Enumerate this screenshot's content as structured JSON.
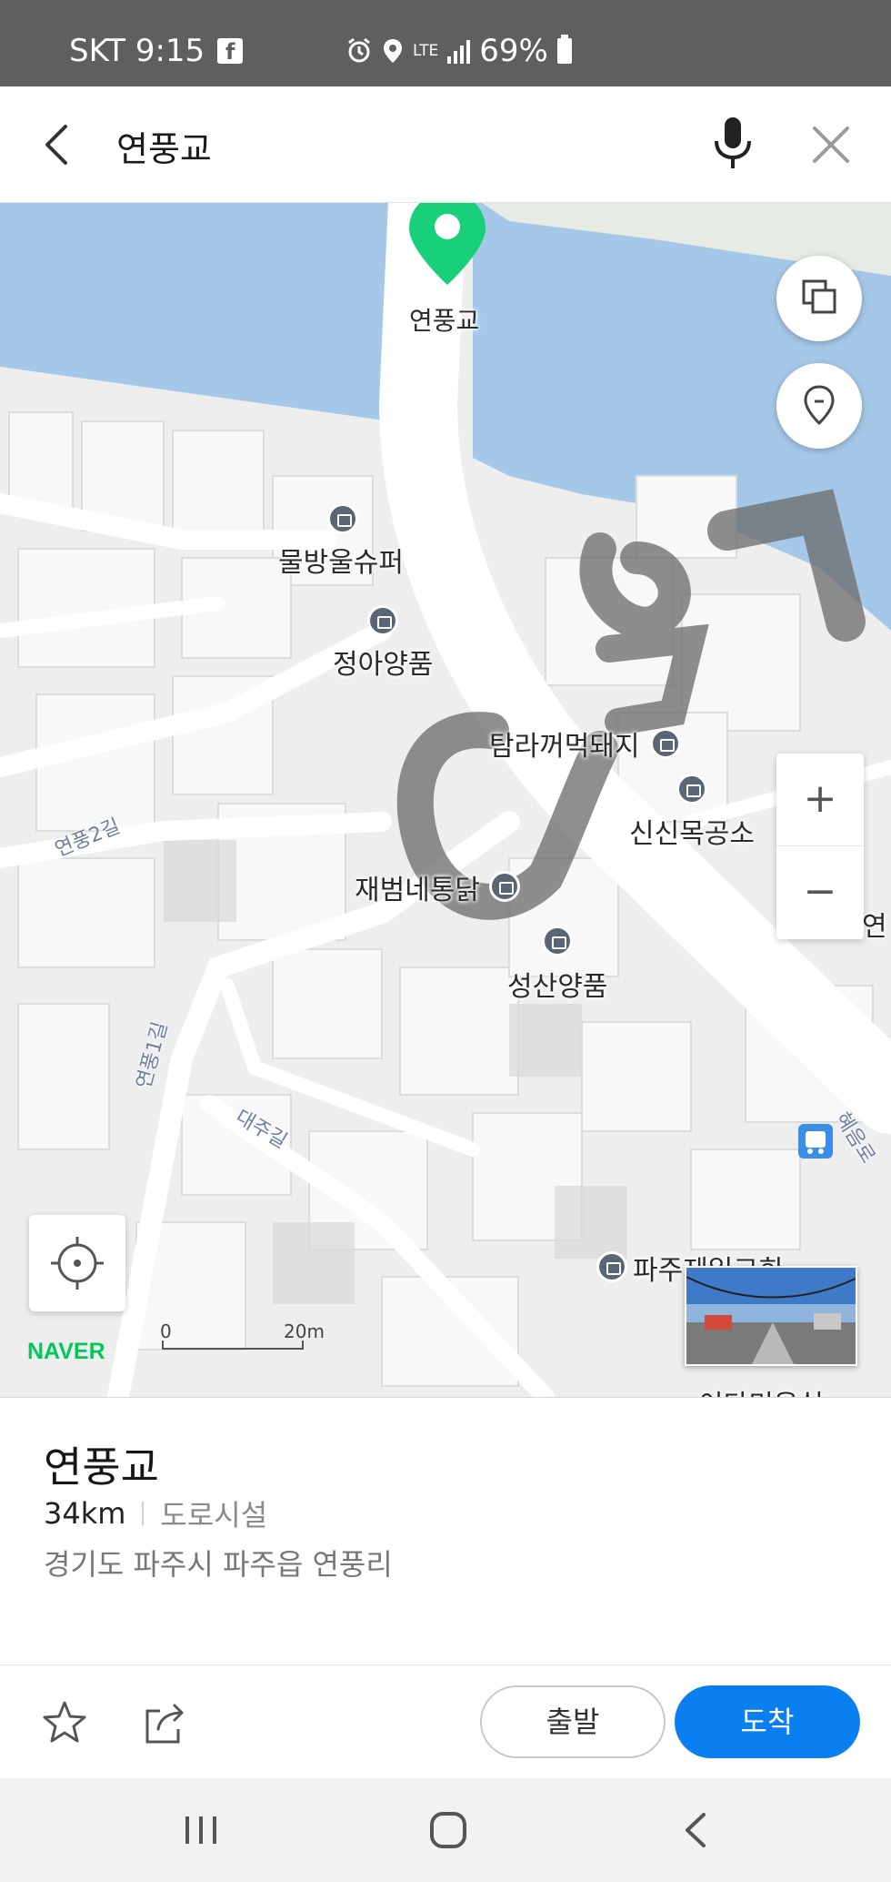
{
  "status_bar": {
    "carrier_time": "SKT 9:15",
    "fb_glyph": "f",
    "lte": "LTE",
    "battery": "69%"
  },
  "search": {
    "query": "연풍교"
  },
  "map": {
    "pin_label": "연풍교",
    "pois": {
      "supermarket": "물방울슈퍼",
      "jeonga": "정아양품",
      "tamra": "탐라꺼먹돼지",
      "sinsin": "신신목공소",
      "jaebeom": "재범네통닭",
      "seongsan": "성산양품",
      "church": "파주제일교회",
      "bottom_poi": "이다미용실",
      "edge_label": "연"
    },
    "roads": {
      "yeonpung2": "연풍2길",
      "yeonpung1": "연풍1길",
      "daeju": "대주길",
      "hyeeum": "혜음로"
    },
    "zoom": {
      "plus": "+",
      "minus": "−"
    },
    "logo": "NAVER",
    "scale": {
      "start": "0",
      "end": "20m"
    },
    "colors": {
      "water": "#a6c8e8",
      "road": "#ffffff",
      "building": "#f6f6f6",
      "pin": "#19d07a"
    }
  },
  "place": {
    "name": "연풍교",
    "distance": "34km",
    "category": "도로시설",
    "address": "경기도 파주시 파주읍 연풍리"
  },
  "actions": {
    "depart": "출발",
    "arrive": "도착"
  }
}
